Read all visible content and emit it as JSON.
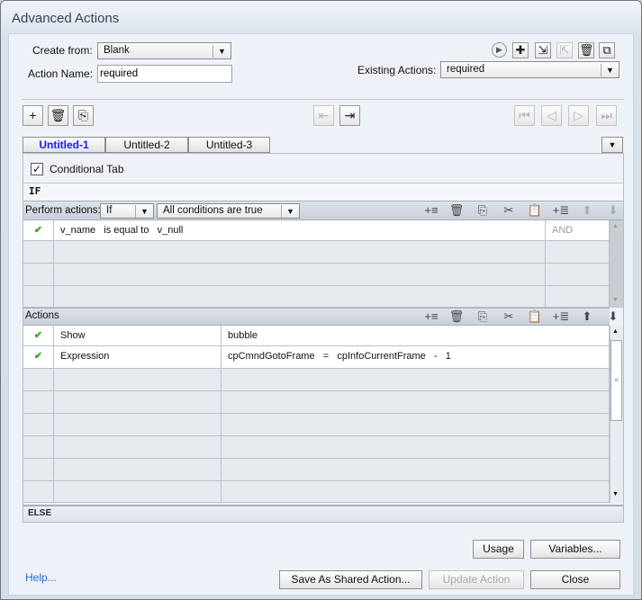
{
  "window": {
    "title": "Advanced Actions"
  },
  "form": {
    "create_from_label": "Create from:",
    "create_from_value": "Blank",
    "action_name_label": "Action Name:",
    "action_name_value": "required",
    "existing_actions_label": "Existing Actions:",
    "existing_actions_value": "required"
  },
  "tabs": [
    {
      "label": "Untitled-1",
      "active": true
    },
    {
      "label": "Untitled-2"
    },
    {
      "label": "Untitled-3"
    }
  ],
  "conditional_tab_label": "Conditional Tab",
  "conditional_tab_checked": true,
  "if_label": "IF",
  "perform": {
    "label": "Perform actions:",
    "mode": "If",
    "condition": "All conditions are true"
  },
  "conditions": [
    {
      "text": "v_name   is equal to   v_null",
      "op": "AND"
    }
  ],
  "actions_label": "Actions",
  "actions": [
    {
      "action": "Show",
      "target": "bubble"
    },
    {
      "action": "Expression",
      "target": "cpCmndGotoFrame   =   cpInfoCurrentFrame   -   1"
    }
  ],
  "else_label": "ELSE",
  "buttons": {
    "usage": "Usage",
    "variables": "Variables...",
    "help": "Help...",
    "save_shared": "Save As Shared Action...",
    "update": "Update Action",
    "close": "Close"
  },
  "colors": {
    "active_tab": "#1a1aff",
    "check": "#3aa51c",
    "link": "#1a6fd6"
  }
}
